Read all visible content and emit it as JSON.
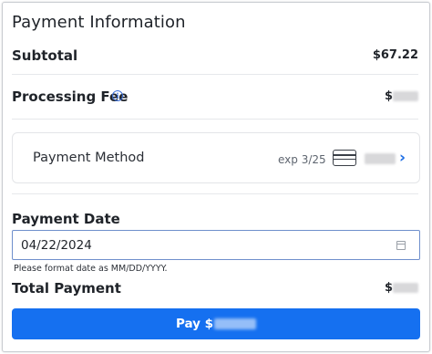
{
  "panel": {
    "title": "Payment Information"
  },
  "summary": {
    "subtotal_label": "Subtotal",
    "subtotal_value": "$67.22",
    "fee_label": "Processing Fee",
    "fee_value_prefix": "$",
    "total_label": "Total Payment",
    "total_value_prefix": "$"
  },
  "payment_method": {
    "label": "Payment Method",
    "expiry": "exp 3/25"
  },
  "payment_date": {
    "label": "Payment Date",
    "value": "04/22/2024",
    "hint": "Please format date as MM/DD/YYYY."
  },
  "pay_button": {
    "label_prefix": "Pay $"
  },
  "colors": {
    "accent": "#1570f0",
    "chevron": "#1f6fe5",
    "info_icon": "#3b6fd9"
  },
  "icons": {
    "info": "info-icon",
    "card": "credit-card-icon",
    "chevron": "chevron-right-icon",
    "calendar": "calendar-icon"
  }
}
